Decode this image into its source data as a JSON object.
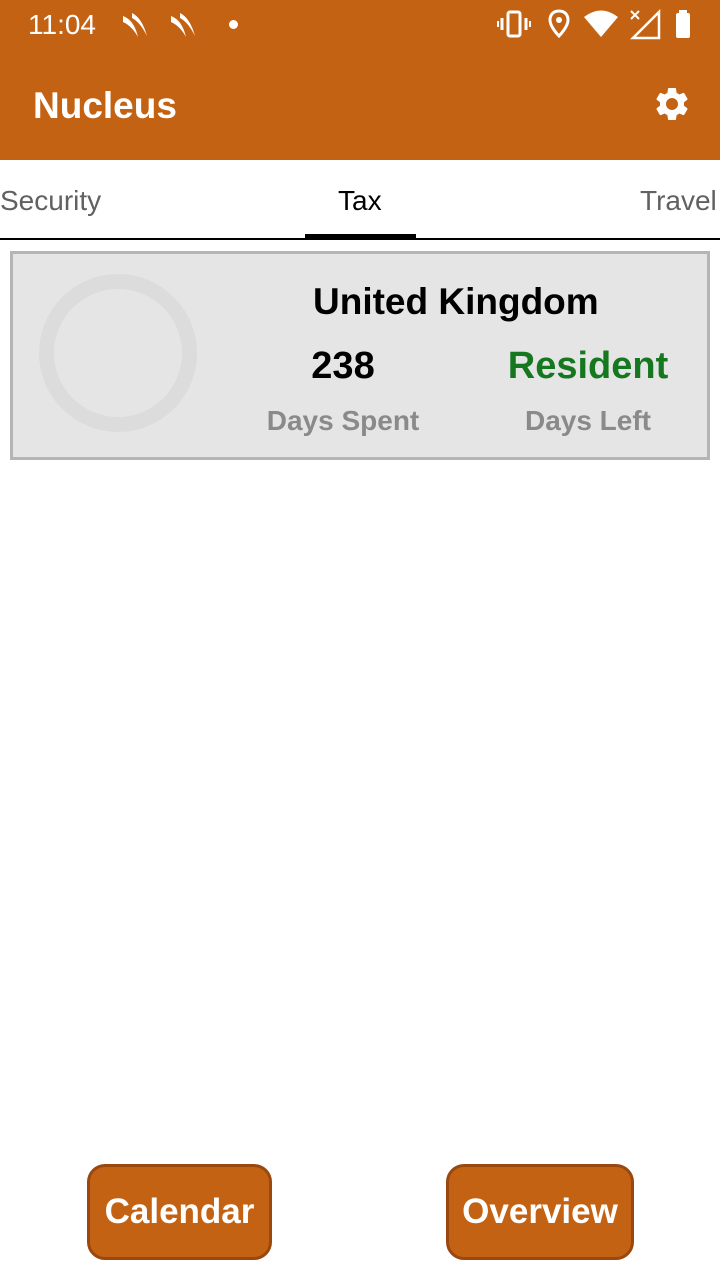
{
  "status_bar": {
    "time": "11:04"
  },
  "app_bar": {
    "title": "Nucleus",
    "settings_icon": "gear-icon"
  },
  "tabs": [
    {
      "label": "Security",
      "active": false
    },
    {
      "label": "Tax",
      "active": true
    },
    {
      "label": "Travel",
      "active": false
    }
  ],
  "tax_card": {
    "country": "United Kingdom",
    "days_spent_value": "238",
    "days_spent_label": "Days Spent",
    "status_value": "Resident",
    "days_left_label": "Days Left"
  },
  "buttons": {
    "calendar_label": "Calendar",
    "overview_label": "Overview"
  },
  "colors": {
    "brand": "#C46213",
    "resident_green": "#15781F",
    "card_bg": "#E5E5E5"
  }
}
